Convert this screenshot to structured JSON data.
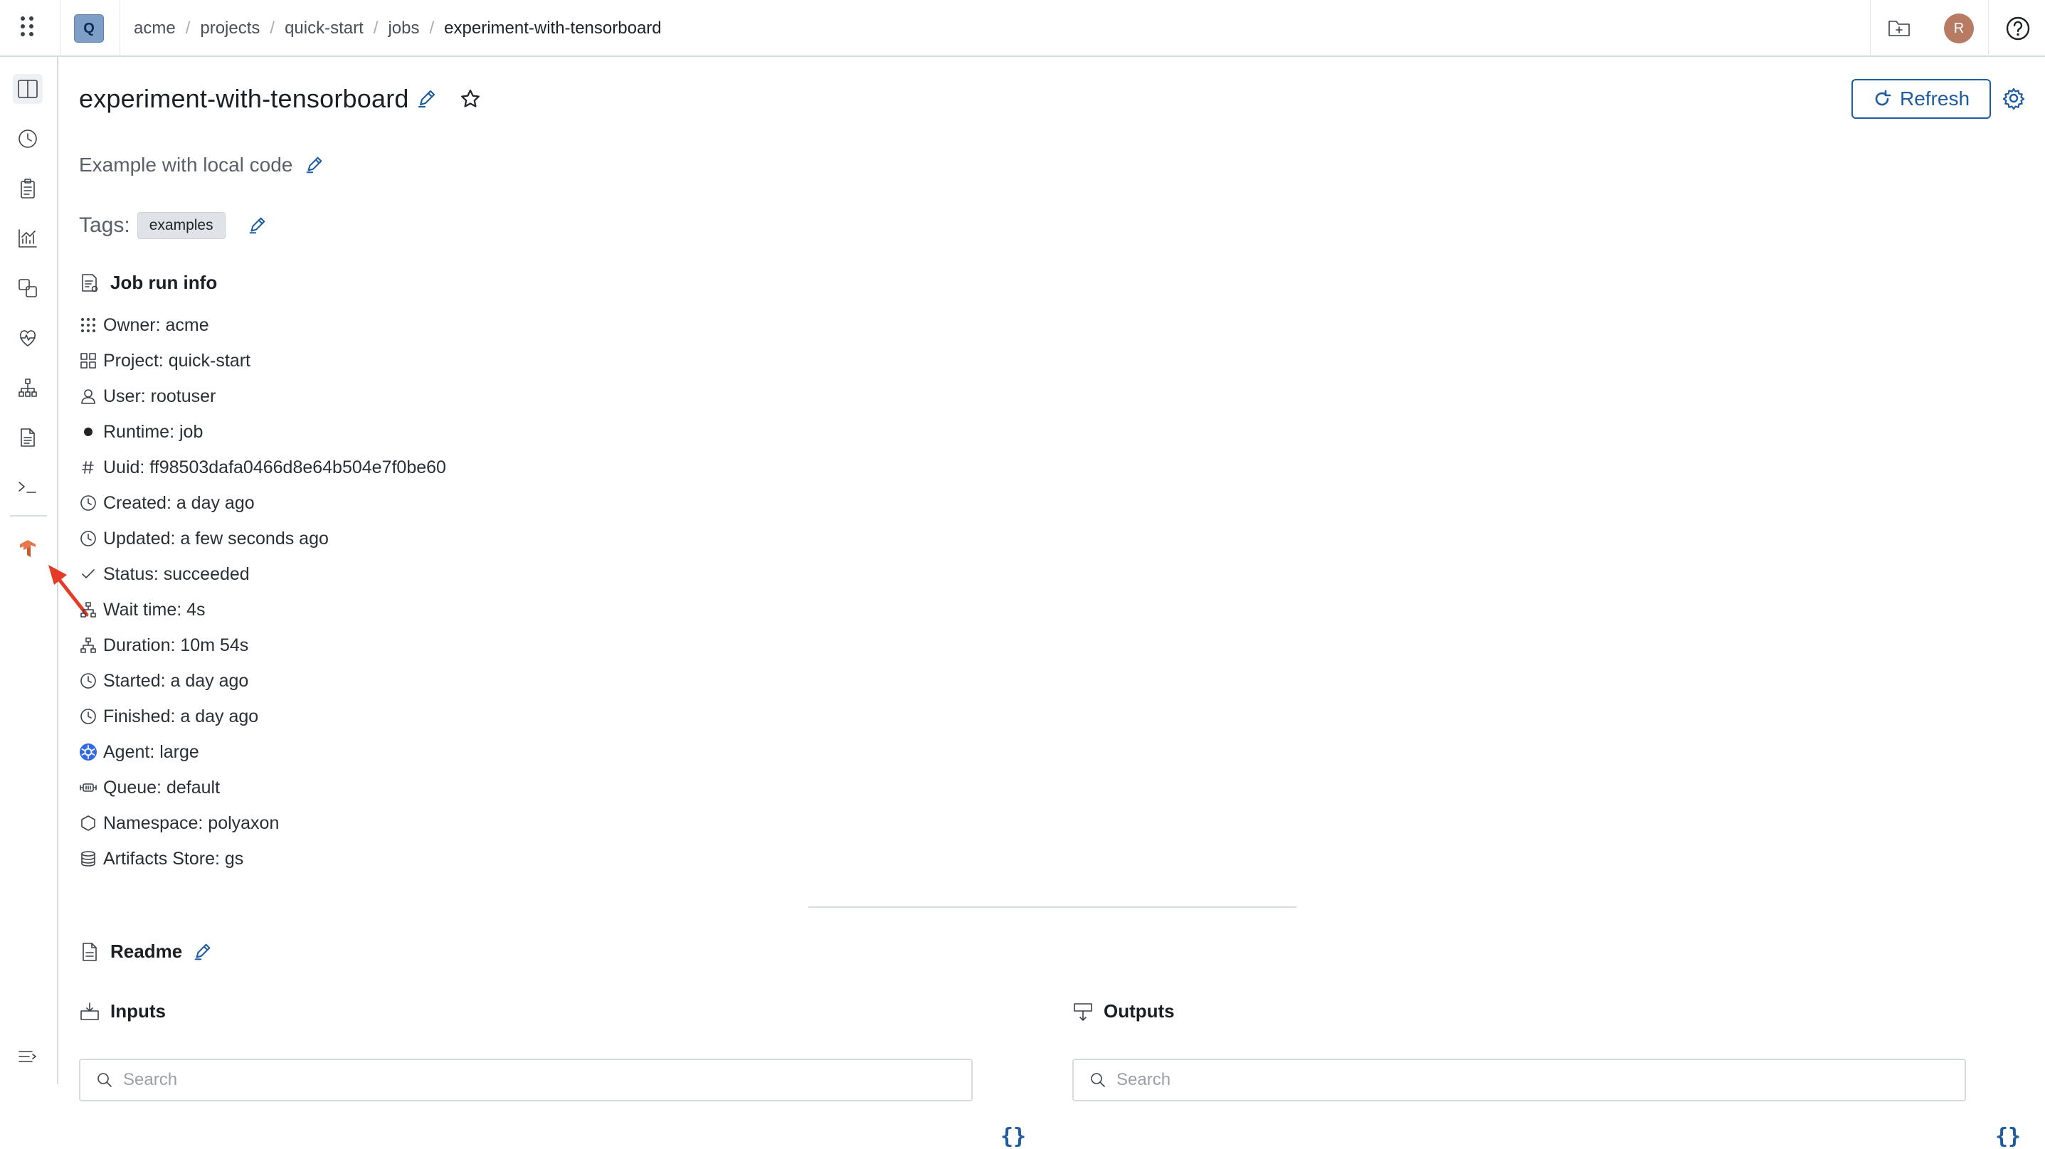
{
  "topbar": {
    "project_initial": "Q",
    "breadcrumb": [
      "acme",
      "projects",
      "quick-start",
      "jobs",
      "experiment-with-tensorboard"
    ],
    "separator": "/",
    "user_initial": "R"
  },
  "sidebar": {
    "items": [
      "overview-panels-icon",
      "runs-history-icon",
      "clipboard-icon",
      "charts-icon",
      "artifacts-icon",
      "health-icon",
      "lineage-icon",
      "logs-document-icon",
      "terminal-icon",
      "tensorboard-icon"
    ],
    "bottom": "expand-sidebar-icon"
  },
  "header": {
    "title": "experiment-with-tensorboard",
    "refresh_label": "Refresh",
    "description": "Example with local code",
    "tags_label": "Tags:",
    "tags": [
      "examples"
    ]
  },
  "job_run_info": {
    "heading": "Job run info",
    "rows": [
      {
        "icon": "owner-grid-icon",
        "text": "Owner: acme"
      },
      {
        "icon": "project-icon",
        "text": "Project: quick-start"
      },
      {
        "icon": "user-icon",
        "text": "User: rootuser"
      },
      {
        "icon": "runtime-dot-icon",
        "text": "Runtime: job"
      },
      {
        "icon": "hash-icon",
        "text": "Uuid: ff98503dafa0466d8e64b504e7f0be60"
      },
      {
        "icon": "clock-icon",
        "text": "Created: a day ago"
      },
      {
        "icon": "clock-icon",
        "text": "Updated: a few seconds ago"
      },
      {
        "icon": "check-icon",
        "text": "Status: succeeded"
      },
      {
        "icon": "hierarchy-icon",
        "text": "Wait time: 4s"
      },
      {
        "icon": "hierarchy-icon",
        "text": "Duration: 10m 54s"
      },
      {
        "icon": "clock-icon",
        "text": "Started: a day ago"
      },
      {
        "icon": "clock-icon",
        "text": "Finished: a day ago"
      },
      {
        "icon": "kubernetes-icon",
        "text": "Agent: large"
      },
      {
        "icon": "queue-icon",
        "text": "Queue: default"
      },
      {
        "icon": "hexagon-icon",
        "text": "Namespace: polyaxon"
      },
      {
        "icon": "database-icon",
        "text": "Artifacts Store: gs"
      }
    ]
  },
  "readme": {
    "heading": "Readme"
  },
  "inputs": {
    "heading": "Inputs",
    "search_placeholder": "Search",
    "json_label": "{}"
  },
  "outputs": {
    "heading": "Outputs",
    "search_placeholder": "Search",
    "json_label": "{}"
  },
  "colors": {
    "accent": "#1f5c9f",
    "tensorboard": "#e8764a",
    "annotation_arrow": "#e53a24"
  }
}
